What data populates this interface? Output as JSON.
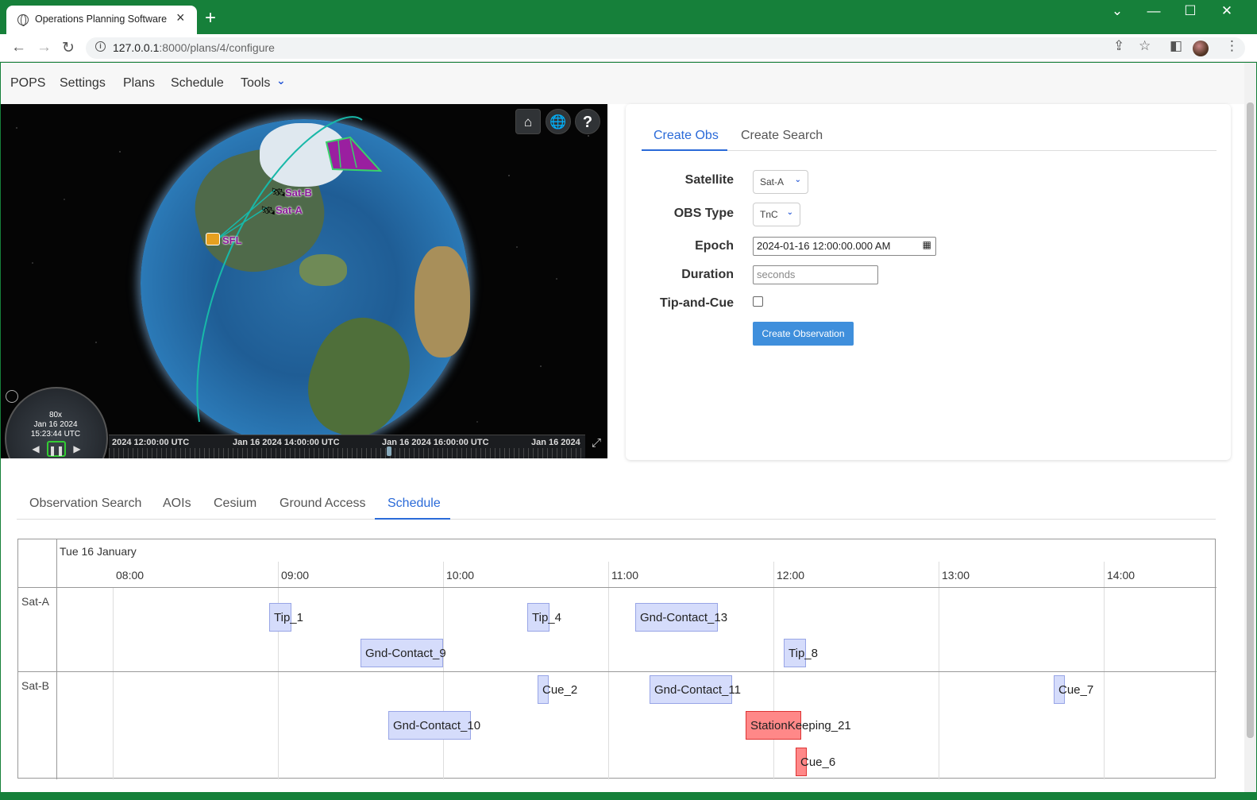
{
  "browser": {
    "tab_title": "Operations Planning Software",
    "url_host": "127.0.0.1",
    "url_rest": ":8000/plans/4/configure"
  },
  "nav": {
    "brand": "POPS",
    "items": [
      "Settings",
      "Plans",
      "Schedule",
      "Tools"
    ]
  },
  "viewer": {
    "labels": {
      "sat_b": "Sat-B",
      "sat_a": "Sat-A",
      "sfl": "SFL"
    },
    "clock": {
      "speed": "80x",
      "date": "Jan 16 2024",
      "time": "15:23:44 UTC"
    },
    "timeline": [
      "2024 12:00:00 UTC",
      "Jan 16 2024 14:00:00 UTC",
      "Jan 16 2024 16:00:00 UTC",
      "Jan 16 2024"
    ]
  },
  "form": {
    "tabs": [
      "Create Obs",
      "Create Search"
    ],
    "satellite_label": "Satellite",
    "satellite_value": "Sat-A",
    "obs_type_label": "OBS Type",
    "obs_type_value": "TnC",
    "epoch_label": "Epoch",
    "epoch_value": "2024-01-16 12:00:00.000 AM",
    "duration_label": "Duration",
    "duration_placeholder": "seconds",
    "tip_cue_label": "Tip-and-Cue",
    "create_button": "Create Observation"
  },
  "bottom_tabs": [
    "Observation Search",
    "AOIs",
    "Cesium",
    "Ground Access",
    "Schedule"
  ],
  "schedule": {
    "date_header": "Tue 16 January",
    "hours": [
      "08:00",
      "09:00",
      "10:00",
      "11:00",
      "12:00",
      "13:00",
      "14:00"
    ],
    "groups": [
      "Sat-A",
      "Sat-B"
    ],
    "items": [
      "Tip_1",
      "Tip_4",
      "Gnd-Contact_13",
      "Gnd-Contact_9",
      "Tip_8",
      "Cue_2",
      "Gnd-Contact_11",
      "Cue_7",
      "Gnd-Contact_10",
      "StationKeeping_21",
      "Cue_6"
    ]
  }
}
